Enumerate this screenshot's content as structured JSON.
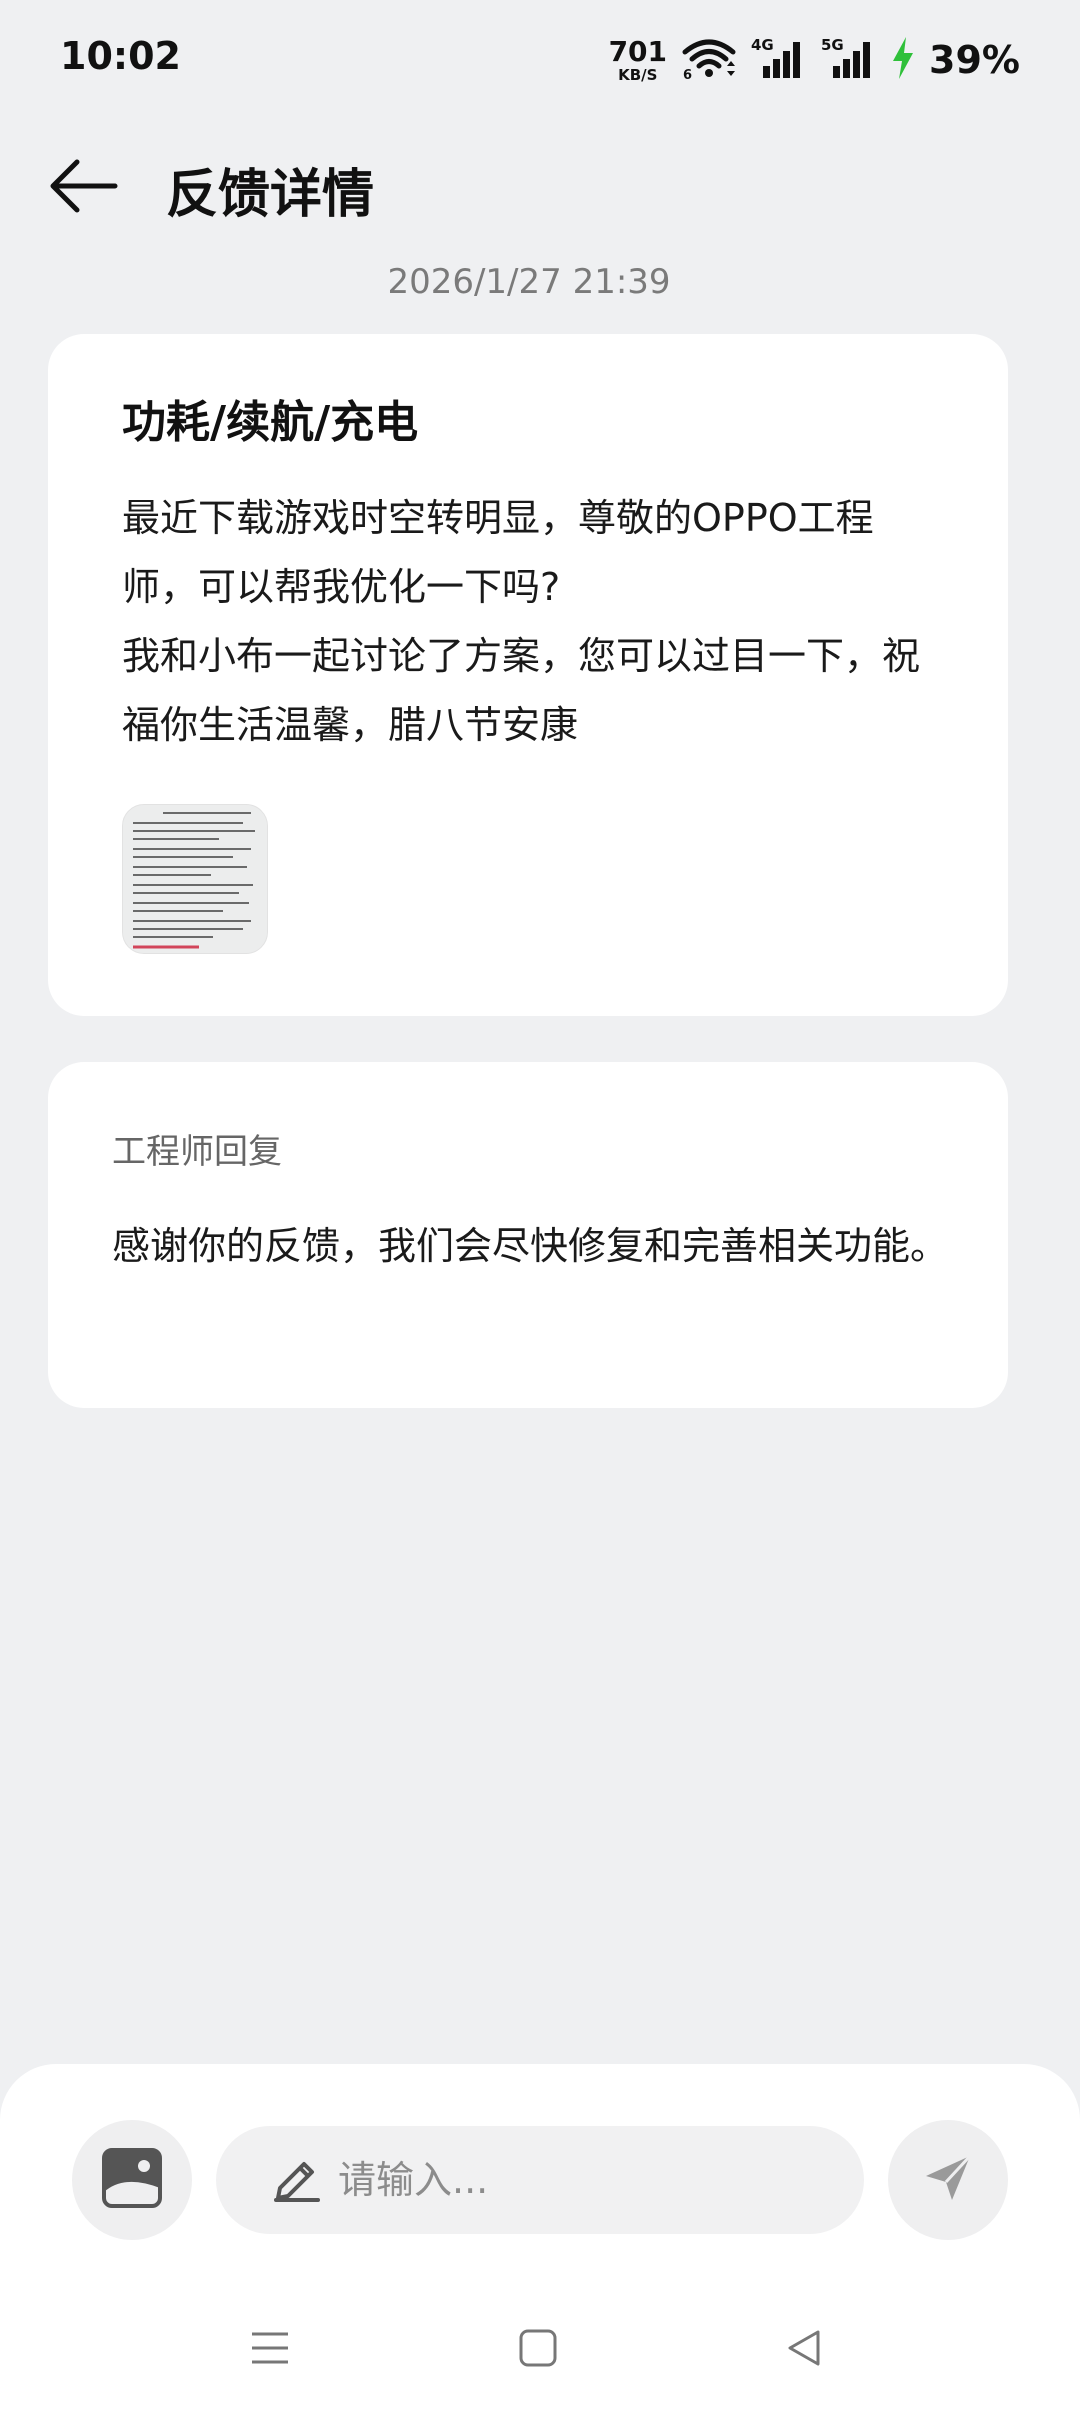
{
  "status_bar": {
    "time": "10:02",
    "net_speed_value": "701",
    "net_speed_unit": "KB/S",
    "battery": "39%",
    "icons": [
      "wifi-icon",
      "signal-4g-icon",
      "signal-5g-icon",
      "charging-icon"
    ],
    "charging_color": "#2fc03a"
  },
  "header": {
    "title": "反馈详情",
    "back_icon": "arrow-left-icon"
  },
  "timestamp": "2026/1/27 21:39",
  "feedback": {
    "category": "功耗/续航/充电",
    "body_lines": [
      "最近下载游戏时空转明显，尊敬的OPPO工程师，可以帮我优化一下吗?",
      "我和小布一起讨论了方案，您可以过目一下，祝福你生活温馨，腊八节安康"
    ],
    "attachment_icon": "document-thumbnail"
  },
  "reply": {
    "label": "工程师回复",
    "body": "感谢你的反馈，我们会尽快修复和完善相关功能。"
  },
  "composer": {
    "image_icon": "image-icon",
    "edit_icon": "pencil-icon",
    "placeholder": "请输入...",
    "value": "",
    "send_icon": "send-icon"
  },
  "nav": {
    "icons": [
      "menu-icon",
      "home-icon",
      "back-triangle-icon"
    ]
  }
}
